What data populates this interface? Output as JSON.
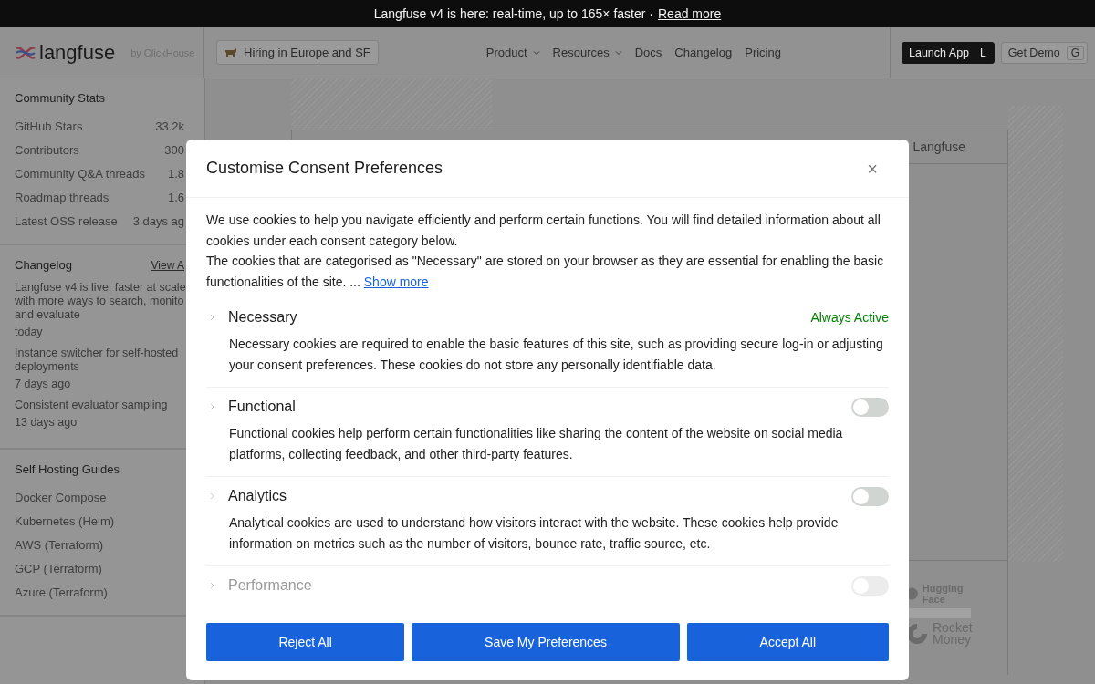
{
  "banner": {
    "text": "Langfuse v4 is here: real-time, up to 165× faster ·",
    "link": "Read more"
  },
  "header": {
    "logo": "langfuse",
    "byline": "by ClickHouse",
    "hiring": "Hiring in Europe and SF",
    "nav": [
      {
        "label": "Product",
        "has_menu": true
      },
      {
        "label": "Resources",
        "has_menu": true
      },
      {
        "label": "Docs",
        "has_menu": false
      },
      {
        "label": "Changelog",
        "has_menu": false
      },
      {
        "label": "Pricing",
        "has_menu": false
      }
    ],
    "actions": [
      {
        "label": "Launch App",
        "key": "L",
        "primary": true
      },
      {
        "label": "Get Demo",
        "key": "G",
        "primary": false
      }
    ]
  },
  "sidebar": {
    "stats": {
      "title": "Community Stats",
      "rows": [
        {
          "label": "GitHub Stars",
          "value": "33.2k"
        },
        {
          "label": "Contributors",
          "value": "300"
        },
        {
          "label": "Community Q&A threads",
          "value": "1.8"
        },
        {
          "label": "Roadmap threads",
          "value": "1.6"
        },
        {
          "label": "Latest OSS release",
          "value": "3 days ag"
        }
      ]
    },
    "changelog": {
      "title": "Changelog",
      "link": "View A",
      "items": [
        {
          "title": "Langfuse v4 is live: faster at scale with more ways to search, monito and evaluate",
          "date": "today"
        },
        {
          "title": "Instance switcher for self-hosted deployments",
          "date": "7 days ago"
        },
        {
          "title": "Consistent evaluator sampling",
          "date": "13 days ago"
        }
      ]
    },
    "guides": {
      "title": "Self Hosting Guides",
      "items": [
        "Docker Compose",
        "Kubernetes (Helm)",
        "AWS (Terraform)",
        "GCP (Terraform)",
        "Azure (Terraform)"
      ]
    }
  },
  "main": {
    "tab_label": "Langfuse",
    "logos": [
      "Hugging Face",
      "Rocket Money"
    ]
  },
  "modal": {
    "title": "Customise Consent Preferences",
    "close": "×",
    "intro": [
      "We use cookies to help you navigate efficiently and perform certain functions. You will find detailed information about all cookies under each consent category below.",
      "The cookies that are categorised as \"Necessary\" are stored on your browser as they are essential for enabling the basic functionalities of the site. ..."
    ],
    "show_more": "Show more",
    "categories": [
      {
        "kind": "always",
        "title": "Necessary",
        "status": "Always Active",
        "description": "Necessary cookies are required to enable the basic features of this site, such as providing secure log-in or adjusting your consent preferences. These cookies do not store any personally identifiable data."
      },
      {
        "kind": "toggle",
        "title": "Functional",
        "on": false,
        "description": "Functional cookies help perform certain functionalities like sharing the content of the website on social media platforms, collecting feedback, and other third-party features."
      },
      {
        "kind": "toggle",
        "title": "Analytics",
        "on": false,
        "description": "Analytical cookies are used to understand how visitors interact with the website. These cookies help provide information on metrics such as the number of visitors, bounce rate, traffic source, etc."
      },
      {
        "kind": "toggle",
        "title": "Performance",
        "on": false
      }
    ],
    "buttons": [
      "Reject All",
      "Save My Preferences",
      "Accept All"
    ]
  }
}
